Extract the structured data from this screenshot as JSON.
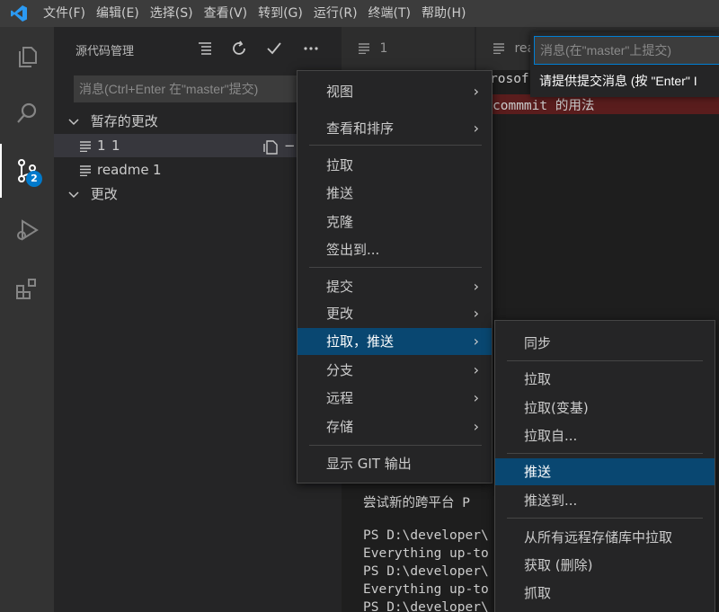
{
  "menubar": [
    "文件(F)",
    "编辑(E)",
    "选择(S)",
    "查看(V)",
    "转到(G)",
    "运行(R)",
    "终端(T)",
    "帮助(H)"
  ],
  "activity": {
    "badge": "2"
  },
  "sidebar": {
    "title": "源代码管理",
    "commit_placeholder": "消息(Ctrl+Enter 在\"master\"提交)",
    "staged_label": "暂存的更改",
    "staged_files": [
      {
        "name": "1",
        "count": "1"
      },
      {
        "name": "readme",
        "count": "1"
      }
    ],
    "changes_label": "更改"
  },
  "editor": {
    "tabs": [
      "1",
      "rea"
    ],
    "line_top": "rosof",
    "line_commit": "commmit 的用法",
    "terminal_lines": [
      "尝试新的跨平台 P",
      "",
      "PS D:\\developer\\",
      "Everything up-to",
      "PS D:\\developer\\",
      "Everything up-to",
      "PS D:\\developer\\"
    ]
  },
  "quick_input": {
    "placeholder": "消息(在\"master\"上提交)",
    "message": "请提供提交消息 (按 \"Enter\" I"
  },
  "context_menu": {
    "items": [
      {
        "label": "视图",
        "submenu": true
      },
      {
        "label": "查看和排序",
        "submenu": true
      },
      {
        "label": "拉取",
        "submenu": false
      },
      {
        "label": "推送",
        "submenu": false
      },
      {
        "label": "克隆",
        "submenu": false
      },
      {
        "label": "签出到...",
        "submenu": false
      },
      {
        "label": "提交",
        "submenu": true
      },
      {
        "label": "更改",
        "submenu": true
      },
      {
        "label": "拉取，推送",
        "submenu": true,
        "highlighted": true
      },
      {
        "label": "分支",
        "submenu": true
      },
      {
        "label": "远程",
        "submenu": true
      },
      {
        "label": "存储",
        "submenu": true
      },
      {
        "label": "显示 GIT 输出",
        "submenu": false
      }
    ]
  },
  "submenu": {
    "items": [
      {
        "label": "同步"
      },
      {
        "label": "拉取"
      },
      {
        "label": "拉取(变基)"
      },
      {
        "label": "拉取自..."
      },
      {
        "label": "推送",
        "highlighted": true
      },
      {
        "label": "推送到..."
      },
      {
        "label": "从所有远程存储库中拉取"
      },
      {
        "label": "获取 (删除)"
      },
      {
        "label": "抓取"
      }
    ]
  },
  "colors": {
    "accent": "#007acc",
    "highlight": "#094771",
    "menu_bg": "#252526"
  }
}
